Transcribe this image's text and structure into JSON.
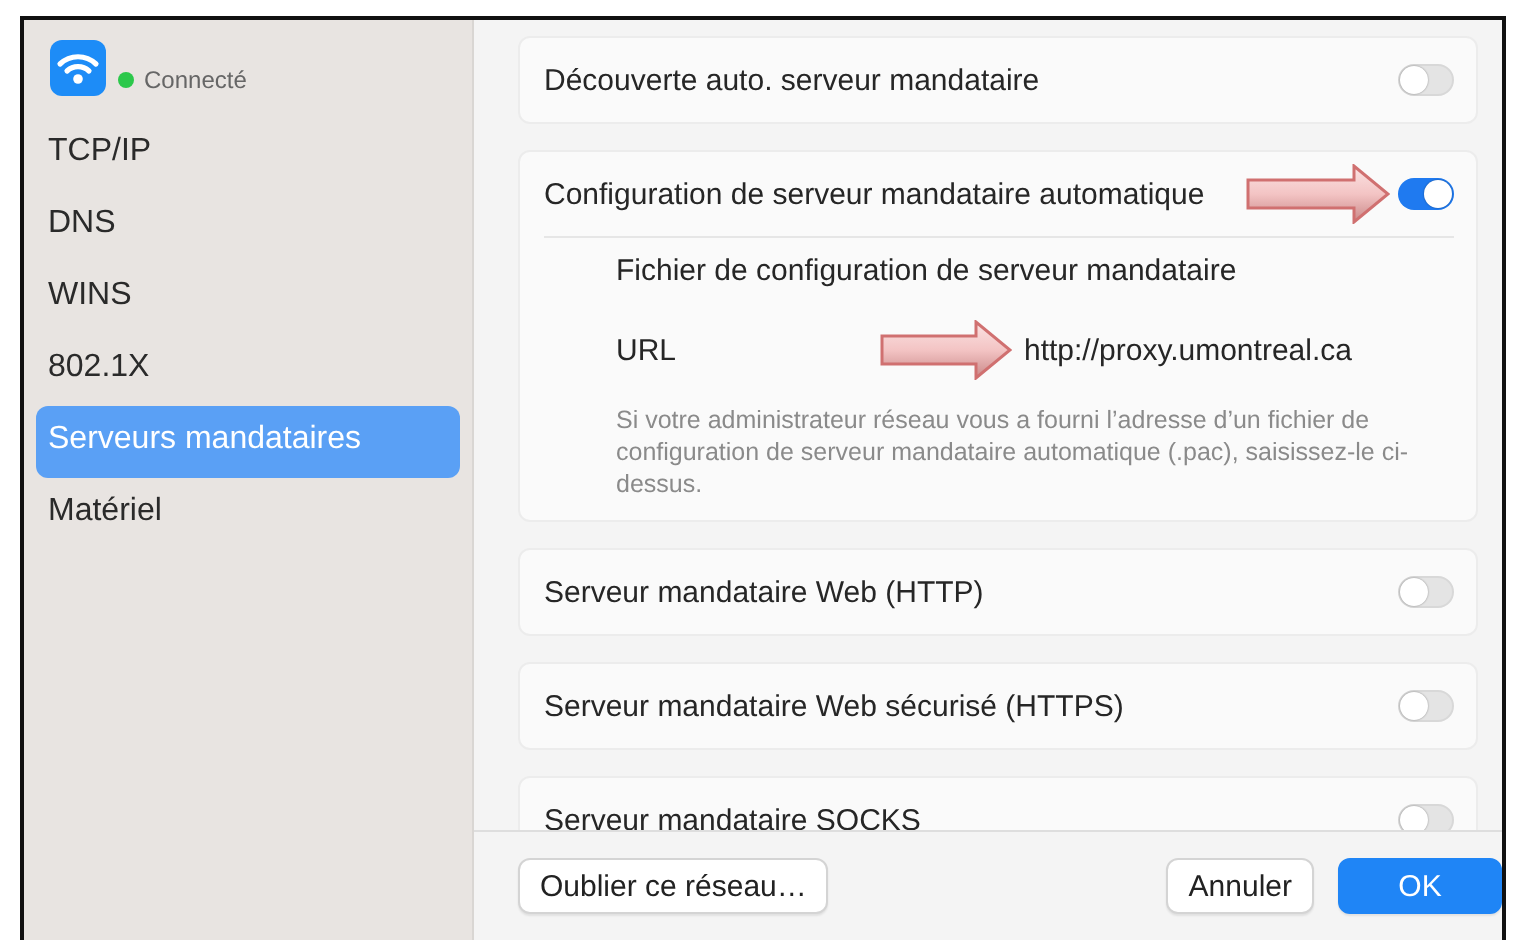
{
  "sidebar": {
    "status": {
      "label": "Connecté",
      "connected": true
    },
    "items": [
      {
        "label": "TCP/IP",
        "selected": false
      },
      {
        "label": "DNS",
        "selected": false
      },
      {
        "label": "WINS",
        "selected": false
      },
      {
        "label": "802.1X",
        "selected": false
      },
      {
        "label": "Serveurs mandataires",
        "selected": true
      },
      {
        "label": "Matériel",
        "selected": false
      }
    ]
  },
  "proxies": [
    {
      "label": "Découverte auto. serveur mandataire",
      "on": false
    },
    {
      "label": "Configuration de serveur mandataire automatique",
      "on": true,
      "details": {
        "heading": "Fichier de configuration de serveur mandataire",
        "url_label": "URL",
        "url_value": "http://proxy.umontreal.ca",
        "help": "Si votre administrateur réseau vous a fourni l’adresse d’un fichier de configuration de serveur mandataire automatique (.pac), saisissez-le ci-dessus."
      }
    },
    {
      "label": "Serveur mandataire Web (HTTP)",
      "on": false
    },
    {
      "label": "Serveur mandataire Web sécurisé (HTTPS)",
      "on": false
    },
    {
      "label": "Serveur mandataire SOCKS",
      "on": false
    }
  ],
  "footer": {
    "buttons": [
      {
        "label": "Oublier ce réseau…",
        "kind": "secondary"
      },
      {
        "label": "Annuler",
        "kind": "secondary"
      },
      {
        "label": "OK",
        "kind": "default"
      }
    ]
  }
}
